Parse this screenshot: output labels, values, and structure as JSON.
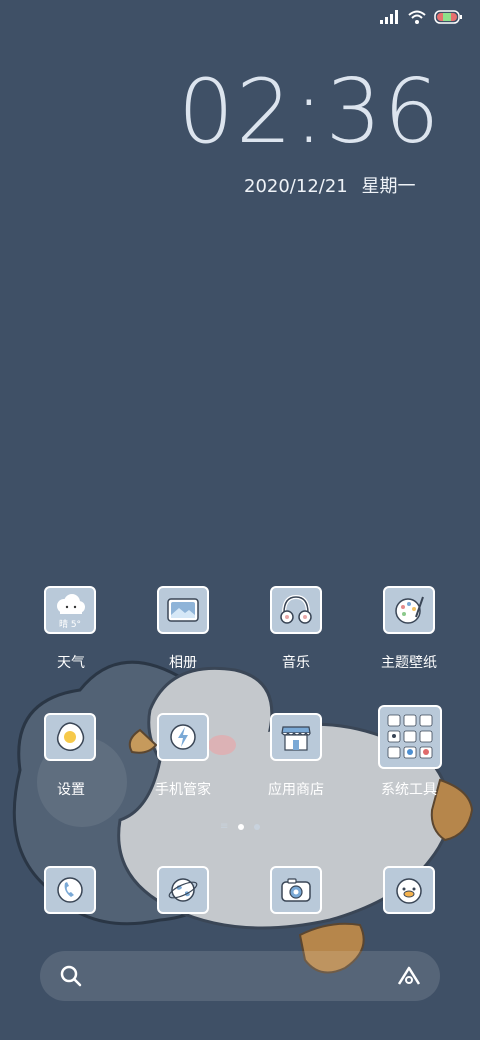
{
  "status_bar": {
    "icons": [
      "signal-icon",
      "wifi-icon",
      "battery-icon"
    ]
  },
  "clock": {
    "time": "02:36",
    "date": "2020/12/21",
    "weekday": "星期一"
  },
  "apps_row1": [
    {
      "label": "天气",
      "icon": "weather-cloud-icon",
      "icon_text": "晴 5°"
    },
    {
      "label": "相册",
      "icon": "gallery-icon"
    },
    {
      "label": "音乐",
      "icon": "headphones-icon"
    },
    {
      "label": "主题壁纸",
      "icon": "palette-icon"
    }
  ],
  "apps_row2": [
    {
      "label": "设置",
      "icon": "settings-egg-icon"
    },
    {
      "label": "手机管家",
      "icon": "security-lightning-icon"
    },
    {
      "label": "应用商店",
      "icon": "store-icon"
    },
    {
      "label": "系统工具",
      "icon": "tools-folder-icon"
    }
  ],
  "dock": [
    {
      "icon": "phone-icon"
    },
    {
      "icon": "browser-globe-icon"
    },
    {
      "icon": "camera-icon"
    },
    {
      "icon": "duck-face-icon"
    }
  ],
  "page_indicator": {
    "pages": 3,
    "current": 2
  },
  "search": {
    "icons": [
      "search-icon",
      "assistant-icon"
    ]
  },
  "colors": {
    "background": "#3f5066",
    "icon_bg": "#b9c9d9",
    "clock": "#dce4ee"
  }
}
